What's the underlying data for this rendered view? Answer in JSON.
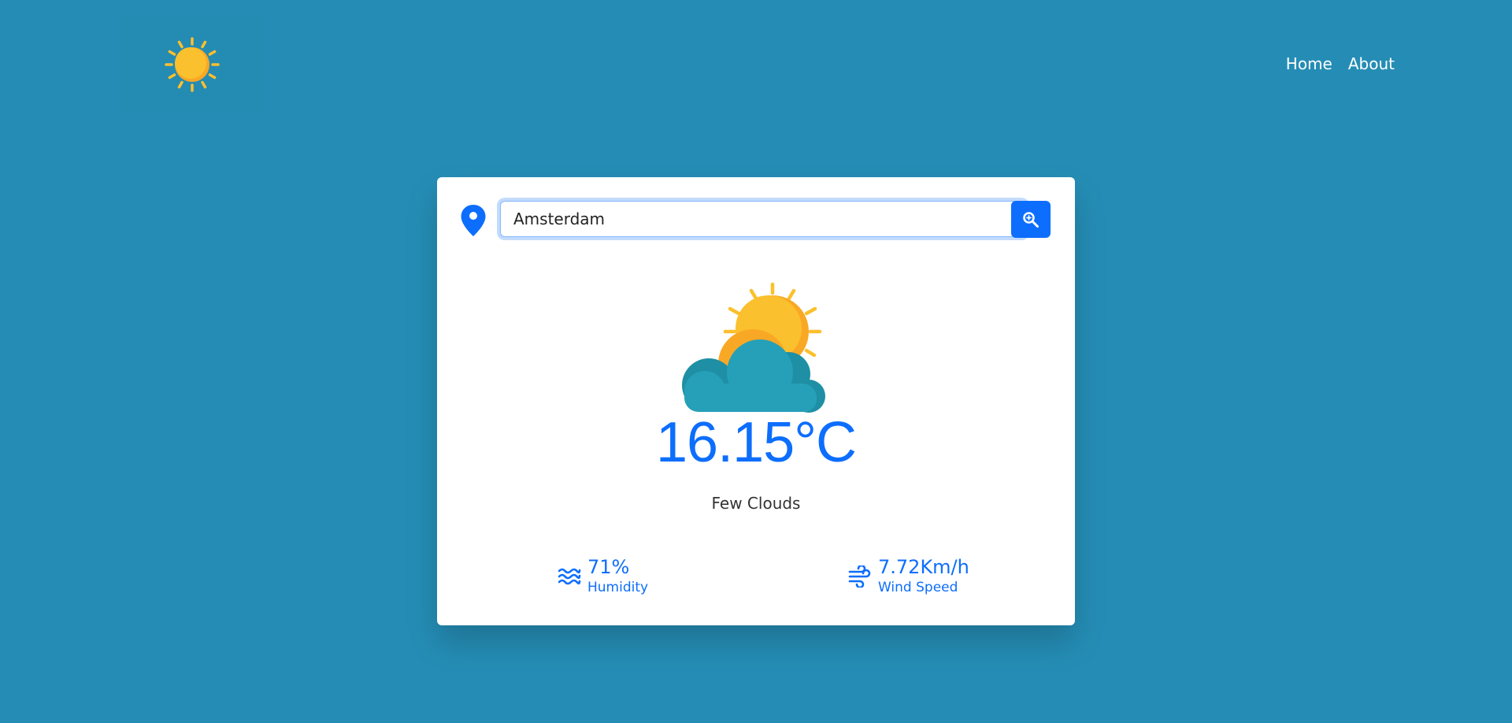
{
  "nav": {
    "home": "Home",
    "about": "About"
  },
  "search": {
    "value": "Amsterdam",
    "button_icon": "search-icon"
  },
  "weather": {
    "icon": "partly-cloudy-icon",
    "temperature": "16.15°C",
    "description": "Few Clouds"
  },
  "stats": {
    "humidity_value": "71%",
    "humidity_label": "Humidity",
    "wind_value": "7.72Km/h",
    "wind_label": "Wind Speed"
  },
  "colors": {
    "background": "#258db5",
    "accent": "#0d6efd",
    "sun": "#fbc02d",
    "cloud": "#25a0b8"
  }
}
